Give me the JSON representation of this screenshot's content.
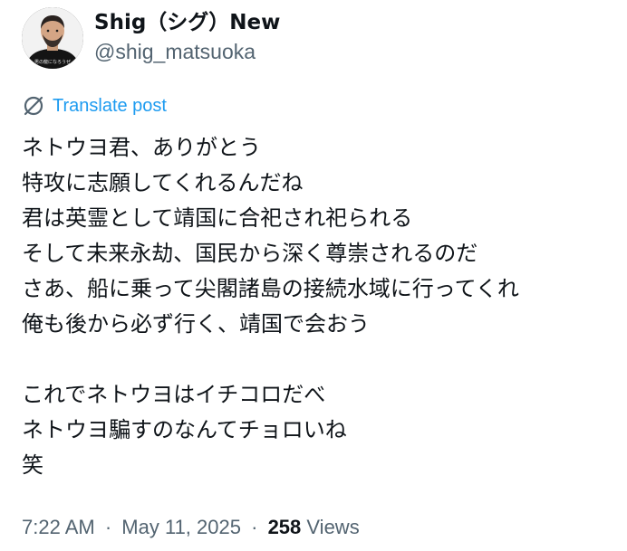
{
  "author": {
    "display_name": "Shig（シグ）New",
    "handle": "@shig_matsuoka",
    "avatar_caption": "男の龍になろうぜ"
  },
  "translate": {
    "label": "Translate post",
    "icon": "translate-icon"
  },
  "post": {
    "lines": [
      "ネトウヨ君、ありがとう",
      "特攻に志願してくれるんだね",
      "君は英霊として靖国に合祀され祀られる",
      "そして未来永劫、国民から深く尊崇されるのだ",
      "さあ、船に乗って尖閣諸島の接続水域に行ってくれ",
      "俺も後から必ず行く、靖国で会おう",
      "",
      "これでネトウヨはイチコロだべ",
      "ネトウヨ騙すのなんてチョロいね",
      "笑"
    ]
  },
  "meta": {
    "time": "7:22 AM",
    "separator": "·",
    "date": "May 11, 2025",
    "views_count": "258",
    "views_label": "Views"
  },
  "colors": {
    "text": "#0f1419",
    "secondary": "#536471",
    "link": "#1d9bf0"
  }
}
